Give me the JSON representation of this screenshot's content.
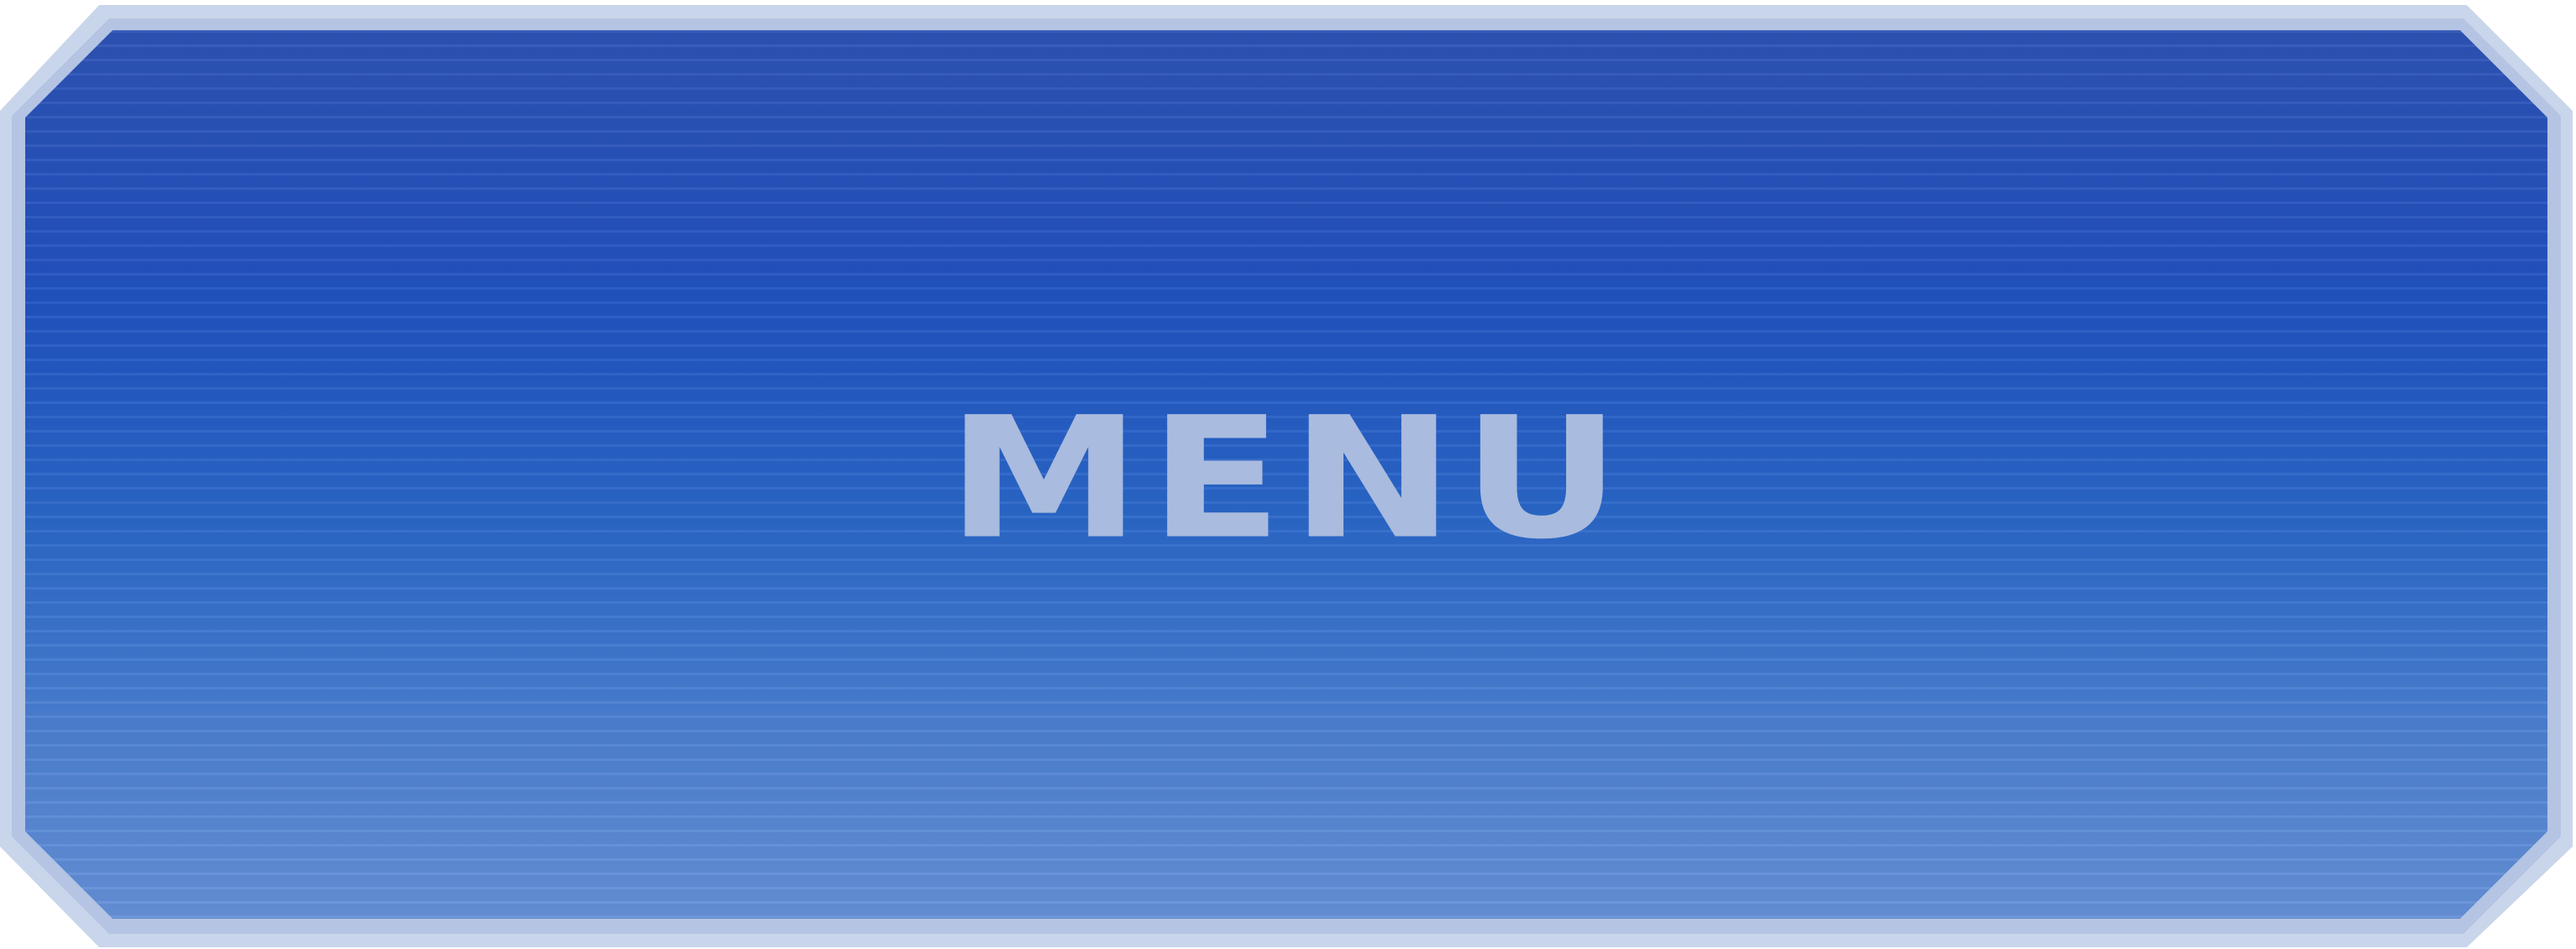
{
  "menu_button": {
    "label": "MENU"
  },
  "colors": {
    "frame": "#c9d5ea",
    "face_top": "#2d52b4",
    "face_bottom": "#6690d8",
    "label": "#a9bbde"
  }
}
